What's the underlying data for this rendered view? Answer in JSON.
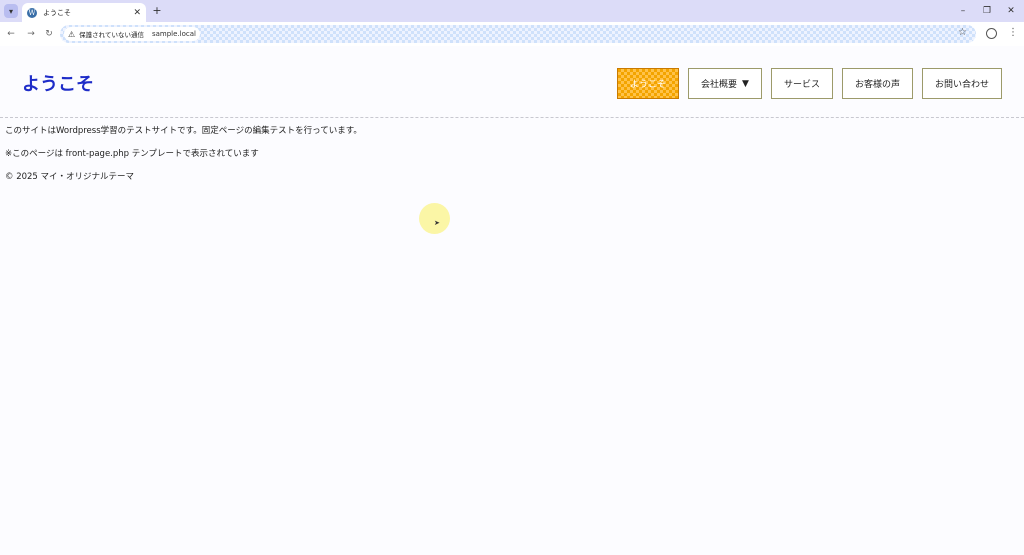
{
  "browser": {
    "tab": {
      "title": "ようこそ",
      "favicon": "wordpress-icon",
      "close_glyph": "✕"
    },
    "new_tab_glyph": "+",
    "window_controls": {
      "minimize": "–",
      "restore": "❐",
      "close": "✕"
    },
    "nav": {
      "back": "←",
      "forward": "→",
      "reload": "↻"
    },
    "address": {
      "security_label": "保護されていない通信",
      "url": "sample.local"
    }
  },
  "site": {
    "title": "ようこそ",
    "nav": [
      {
        "label": "ようこそ",
        "active": true
      },
      {
        "label": "会社概要",
        "dropdown": "▼"
      },
      {
        "label": "サービス"
      },
      {
        "label": "お客様の声"
      },
      {
        "label": "お問い合わせ"
      }
    ],
    "content": {
      "paragraph1": "このサイトはWordpress学習のテストサイトです。固定ページの編集テストを行っています。",
      "paragraph2": "※このページは front-page.php テンプレートで表示されています",
      "footer": "© 2025 マイ・オリジナルテーマ"
    }
  },
  "colors": {
    "accent": "#f3a400",
    "title": "#1e2cc8",
    "tabbar": "#dcdcf8"
  }
}
